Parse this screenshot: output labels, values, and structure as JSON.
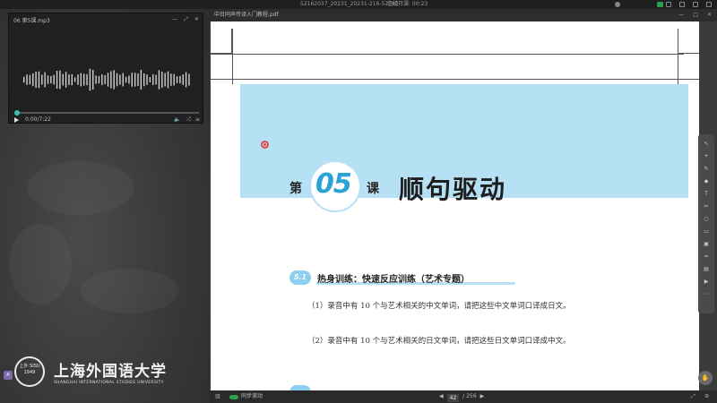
{
  "window": {
    "title": "52162037_20231_20231-216-52162...",
    "status": "已经开课: 00:23"
  },
  "player": {
    "filename": "06 第5课.mp3",
    "time": "0:00/7:22",
    "progress": 0.0,
    "buttons": [
      "play",
      "volume",
      "shuffle",
      "playlist"
    ]
  },
  "logo": {
    "seal_text": "上外 SISU 1949",
    "name_cn": "上海外国语大学",
    "name_en": "SHANGHAI INTERNATIONAL STUDIES UNIVERSITY",
    "avatar": "A"
  },
  "viewer": {
    "filename": "中日同声传译入门教程.pdf",
    "page": {
      "lesson_prefix": "第",
      "lesson_number": "05",
      "lesson_suffix": "课",
      "lesson_title": "顺句驱动",
      "section_number": "5.1",
      "section_title": "热身训练：快速反应训练（艺术专题）",
      "items": [
        "（1）录音中有 10 个与艺术相关的中文单词，请把这些中文单词口译成日文。",
        "（2）录音中有 10 个与艺术相关的日文单词，请把这些日文单词口译成中文。"
      ]
    },
    "bottom": {
      "sync_label": "同步滚动",
      "current_page": "42",
      "total_pages": "/ 256"
    }
  },
  "colors": {
    "banner": "#b6e1f4",
    "lesson_number": "#29a3d6",
    "section_badge": "#8ccfee",
    "progress_knob": "#3dbfb0"
  }
}
